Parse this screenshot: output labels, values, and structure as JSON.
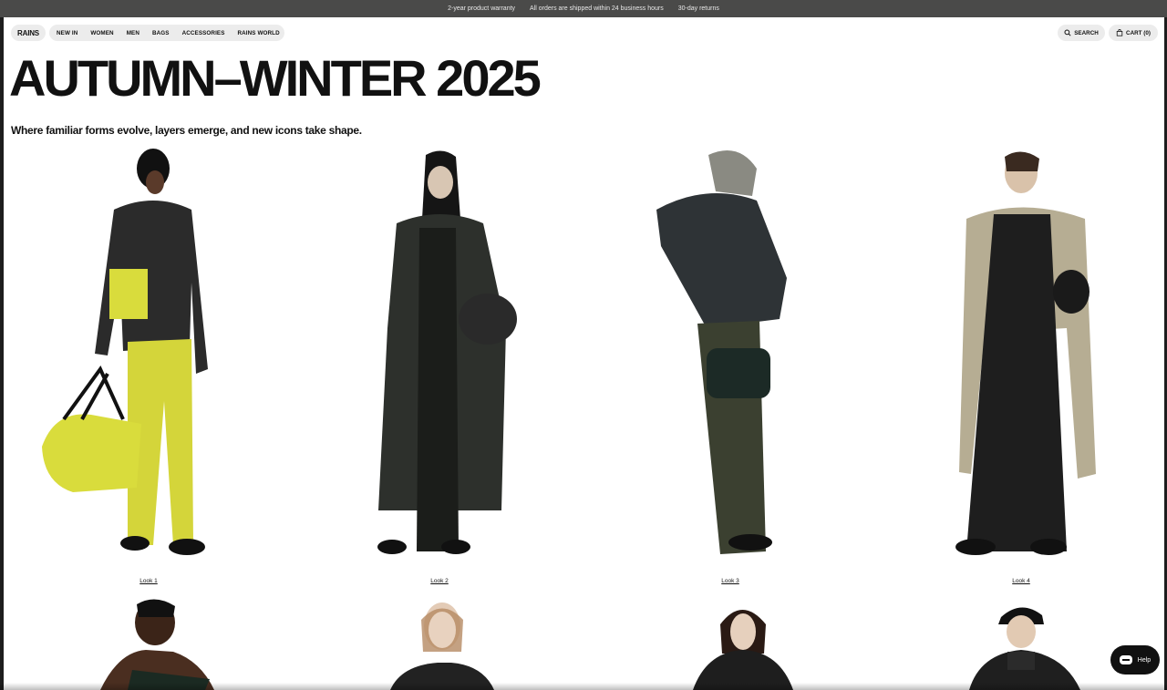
{
  "announcement": {
    "items": [
      "2-year product warranty",
      "All orders are shipped within 24 business hours",
      "30-day returns"
    ]
  },
  "nav": {
    "logo": "RAINS",
    "menu": [
      "NEW IN",
      "WOMEN",
      "MEN",
      "BAGS",
      "ACCESSORIES",
      "RAINS WORLD"
    ],
    "search_label": "SEARCH",
    "cart_label": "CART (0)"
  },
  "hero": {
    "title": "AUTUMN–WINTER 2025",
    "subtitle": "Where familiar forms evolve, layers emerge, and new icons take shape."
  },
  "looks": [
    {
      "label": "Look 1"
    },
    {
      "label": "Look 2"
    },
    {
      "label": "Look 3"
    },
    {
      "label": "Look 4"
    }
  ],
  "help": {
    "label": "Help"
  },
  "colors": {
    "announcement_bg": "#4a4a49",
    "pill_bg": "#ececec",
    "accent_yellow": "#d9dc3c"
  }
}
